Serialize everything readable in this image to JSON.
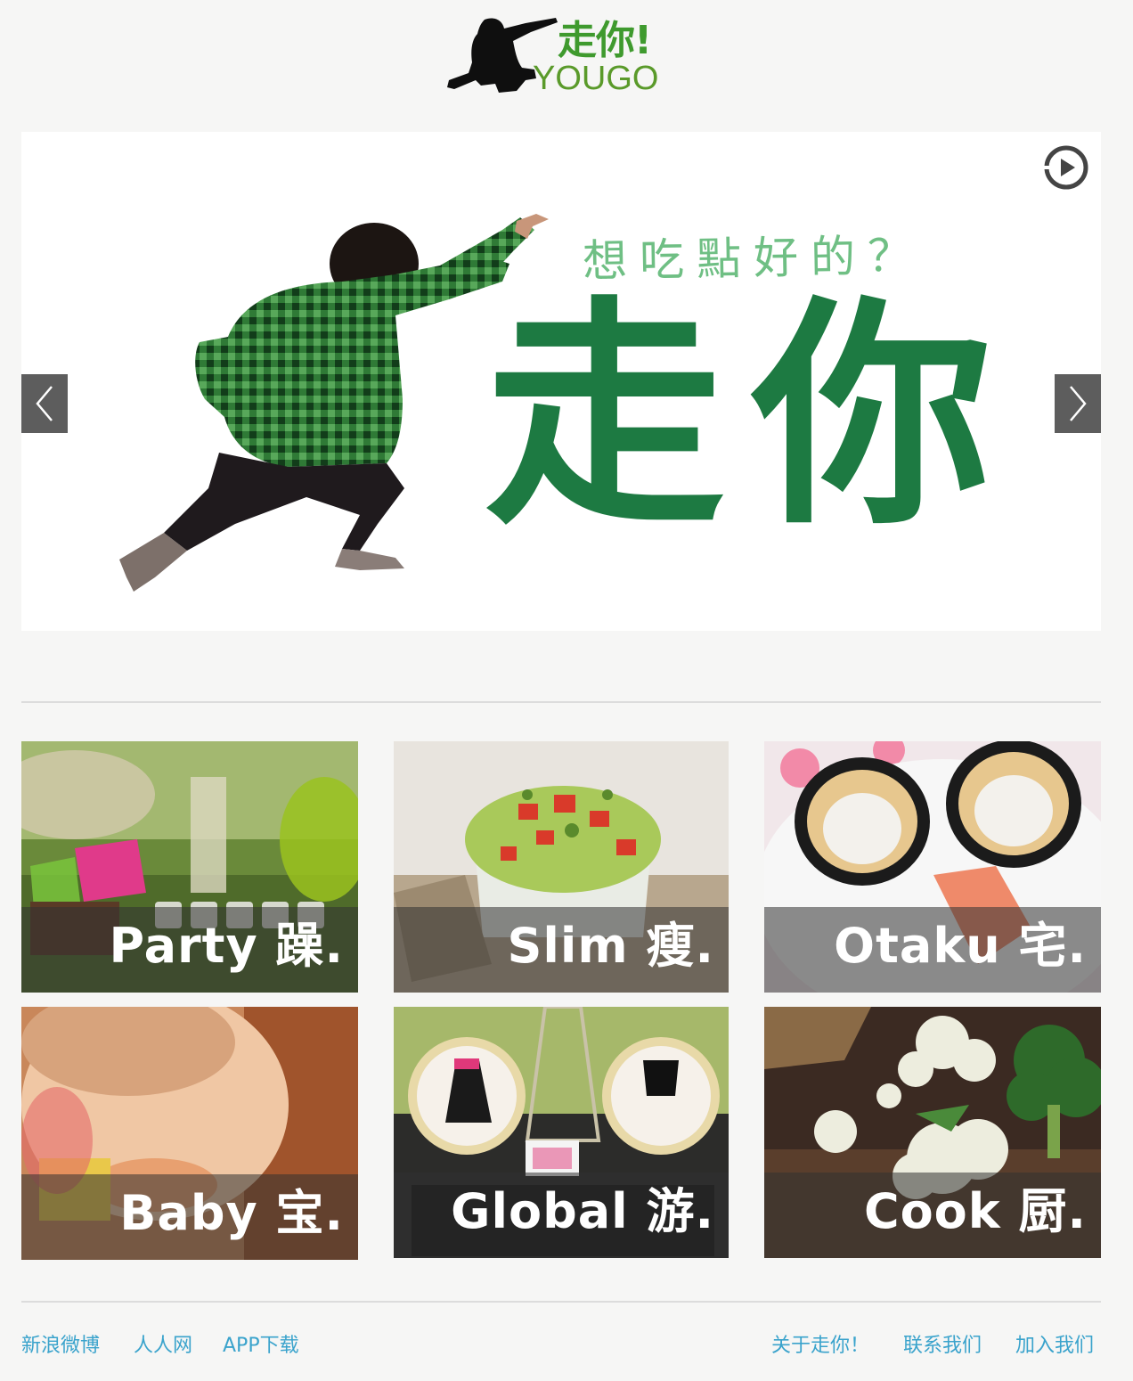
{
  "header": {
    "logo_cn": "走你!",
    "logo_en": "YOUGO"
  },
  "hero": {
    "question": "想吃點好的？",
    "title": "走你",
    "prev_icon": "chevron-left-icon",
    "next_icon": "chevron-right-icon",
    "play_icon": "play-icon"
  },
  "categories": [
    {
      "label": "Party 躁."
    },
    {
      "label": "Slim 瘦."
    },
    {
      "label": "Otaku 宅."
    },
    {
      "label": "Baby 宝."
    },
    {
      "label": "Global 游."
    },
    {
      "label": "Cook 厨."
    }
  ],
  "footer": {
    "left": [
      "新浪微博",
      "人人网",
      "APP下载"
    ],
    "right": [
      "关于走你！",
      "联系我们",
      "加入我们"
    ]
  },
  "colors": {
    "brand_green": "#1d7a42",
    "logo_green": "#3f9a2e",
    "link_blue": "#3aa3cc",
    "background": "#f6f6f5"
  }
}
